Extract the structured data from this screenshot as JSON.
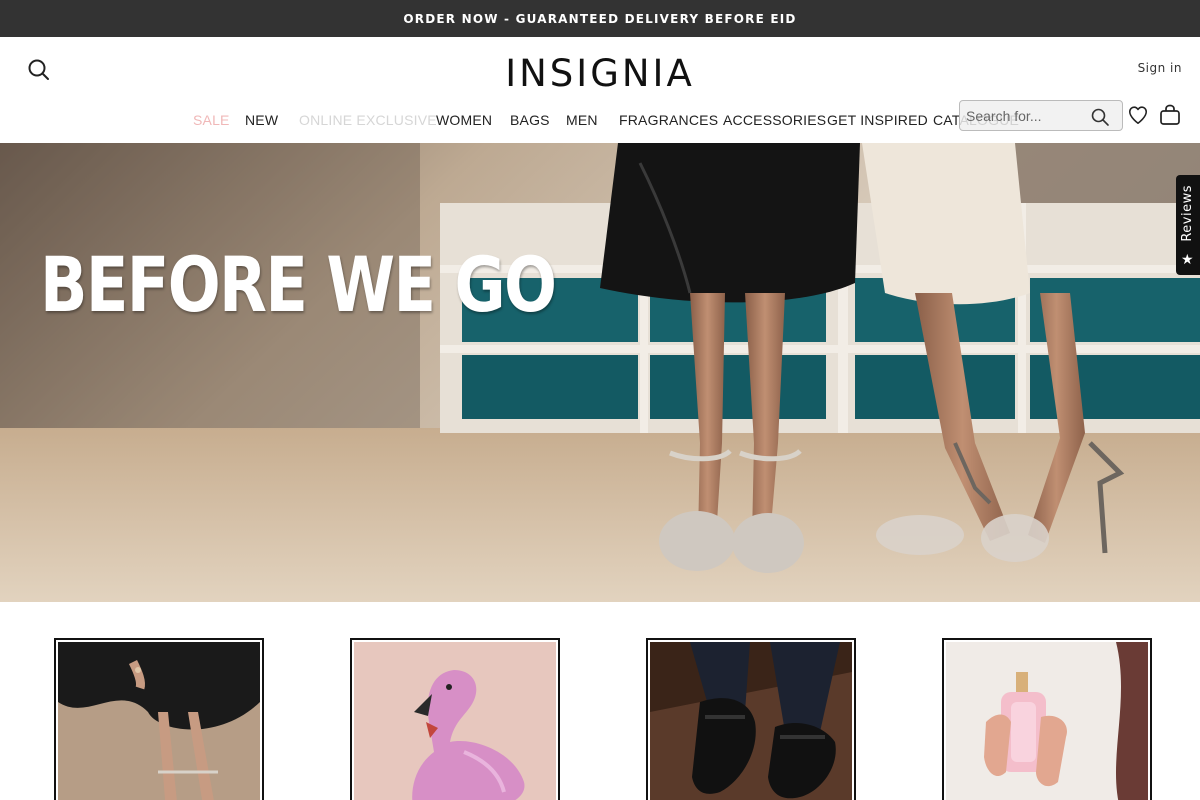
{
  "announcement": {
    "text": "ORDER NOW - GUARANTEED DELIVERY BEFORE EID"
  },
  "header": {
    "logo": "INSIGNIA",
    "sign_in": "Sign in",
    "search_placeholder": "Search for..."
  },
  "nav": {
    "items": [
      {
        "label": "SALE",
        "color": "#f0b8b8"
      },
      {
        "label": "NEW",
        "color": "#222222"
      },
      {
        "label": "ONLINE EXCLUSIVE",
        "color": "#d6d6d6"
      },
      {
        "label": "WOMEN",
        "color": "#222222"
      },
      {
        "label": "BAGS",
        "color": "#222222"
      },
      {
        "label": "MEN",
        "color": "#222222"
      },
      {
        "label": "FRAGRANCES",
        "color": "#222222"
      },
      {
        "label": "ACCESSORIES",
        "color": "#222222"
      },
      {
        "label": "GET INSPIRED",
        "color": "#222222"
      },
      {
        "label": "CATALOGUE",
        "color": "#222222"
      }
    ]
  },
  "hero": {
    "title": "BEFORE WE GO"
  },
  "reviews_tab": {
    "label": "Reviews",
    "icon": "star-icon"
  },
  "tiles": [
    {
      "name": "women-shoes-tile"
    },
    {
      "name": "flamingo-bag-tile"
    },
    {
      "name": "men-loafers-tile"
    },
    {
      "name": "fragrance-tile"
    }
  ],
  "colors": {
    "announcement_bg": "#333333",
    "accent_sale": "#f0b8b8",
    "text": "#222222"
  }
}
